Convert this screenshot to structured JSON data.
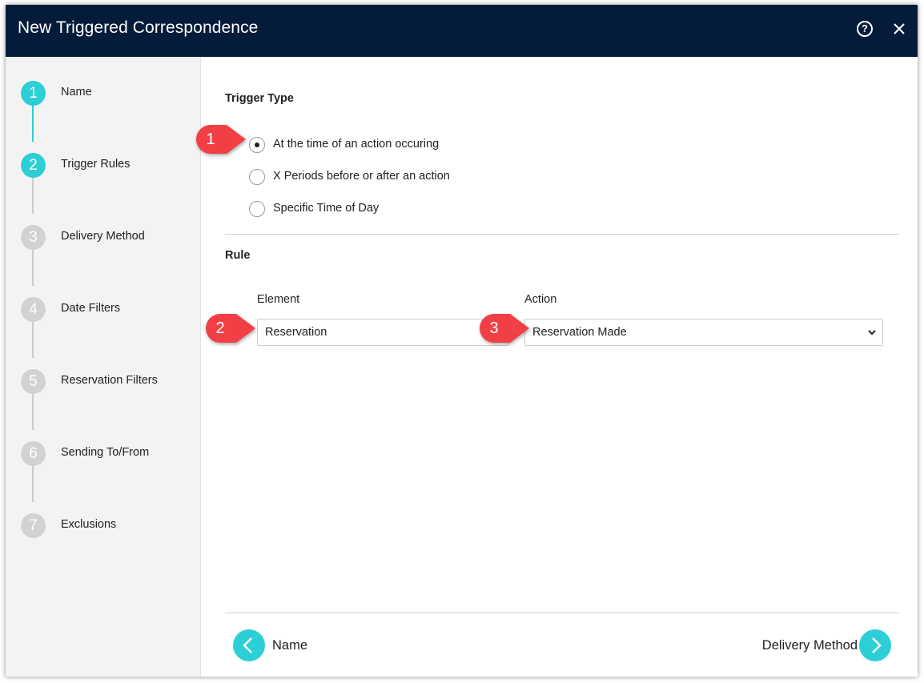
{
  "dialog": {
    "title": "New Triggered Correspondence"
  },
  "colors": {
    "header_bg": "#041c3a",
    "accent": "#2ccfd6",
    "inactive_step": "#d2d2d2",
    "callout": "#f23f46"
  },
  "icons": {
    "help": "help-circle-icon",
    "close": "close-icon",
    "back": "chevron-left-icon",
    "next": "chevron-right-icon",
    "dropdown": "chevron-down-icon"
  },
  "steps": [
    {
      "number": "1",
      "label": "Name",
      "state": "completed"
    },
    {
      "number": "2",
      "label": "Trigger Rules",
      "state": "current"
    },
    {
      "number": "3",
      "label": "Delivery Method",
      "state": "pending"
    },
    {
      "number": "4",
      "label": "Date Filters",
      "state": "pending"
    },
    {
      "number": "5",
      "label": "Reservation Filters",
      "state": "pending"
    },
    {
      "number": "6",
      "label": "Sending To/From",
      "state": "pending"
    },
    {
      "number": "7",
      "label": "Exclusions",
      "state": "pending"
    }
  ],
  "trigger_type": {
    "heading": "Trigger Type",
    "options": [
      {
        "label": "At the time of an action occuring",
        "selected": true
      },
      {
        "label": "X Periods before or after an action",
        "selected": false
      },
      {
        "label": "Specific Time of Day",
        "selected": false
      }
    ]
  },
  "rule": {
    "heading": "Rule",
    "element_label": "Element",
    "element_value": "Reservation",
    "action_label": "Action",
    "action_value": "Reservation Made"
  },
  "callouts": [
    "1",
    "2",
    "3"
  ],
  "footer": {
    "back_label": "Name",
    "next_label": "Delivery Method"
  }
}
